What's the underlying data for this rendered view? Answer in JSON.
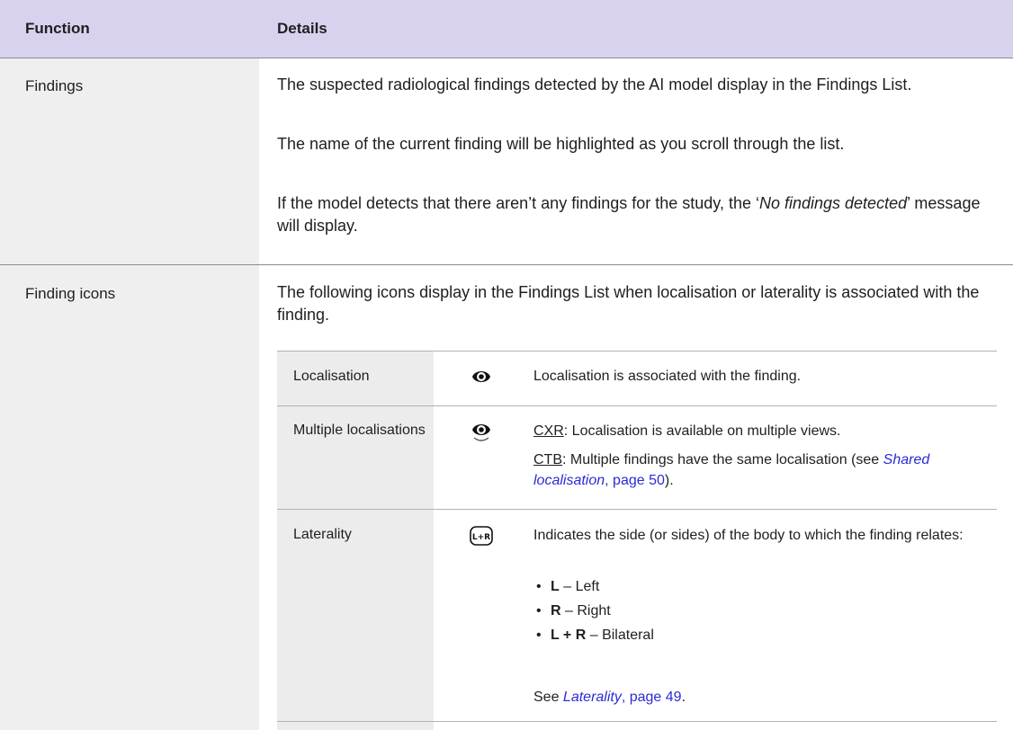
{
  "header": {
    "col1": "Function",
    "col2": "Details"
  },
  "findings": {
    "name": "Findings",
    "p1": "The suspected radiological findings detected by the AI model display in the Findings List.",
    "p2": "The name of the current finding will be highlighted as you scroll through the list.",
    "p3_a": "If the model detects that there aren’t any findings for the study, the ‘",
    "p3_em": "No findings detected",
    "p3_b": "’ message will display."
  },
  "finding_icons": {
    "name": "Finding icons",
    "intro": "The following icons display in the Findings List when localisation or laterality is associated with the finding.",
    "rows": [
      {
        "label": "Localisation",
        "icon": "eye-icon",
        "text": "Localisation is associated with the finding."
      },
      {
        "label": "Multiple localisations",
        "icon": "eye-multiple-icon",
        "cxr_tag": "CXR",
        "cxr_text": ": Localisation is available on multiple views.",
        "ctb_tag": "CTB",
        "ctb_text_a": ": Multiple findings have the same localisation (see ",
        "ctb_link_em": "Shared localisation",
        "ctb_link_page": ", page 50",
        "ctb_text_b": ")."
      },
      {
        "label": "Laterality",
        "icon": "laterality-icon",
        "icon_text": "L+R",
        "text": "Indicates the side (or sides) of the body to which the finding relates:",
        "bullets": [
          {
            "key": "L",
            "desc": " – Left"
          },
          {
            "key": "R",
            "desc": " – Right"
          },
          {
            "key": "L + R",
            "desc": " – Bilateral"
          }
        ],
        "see_a": "See ",
        "see_link_em": "Laterality",
        "see_link_page": ", page 49",
        "see_b": "."
      }
    ]
  },
  "colors": {
    "header_bg": "#d9d2ef",
    "link": "#2b2bd6",
    "function_col_bg": "#efefef"
  }
}
